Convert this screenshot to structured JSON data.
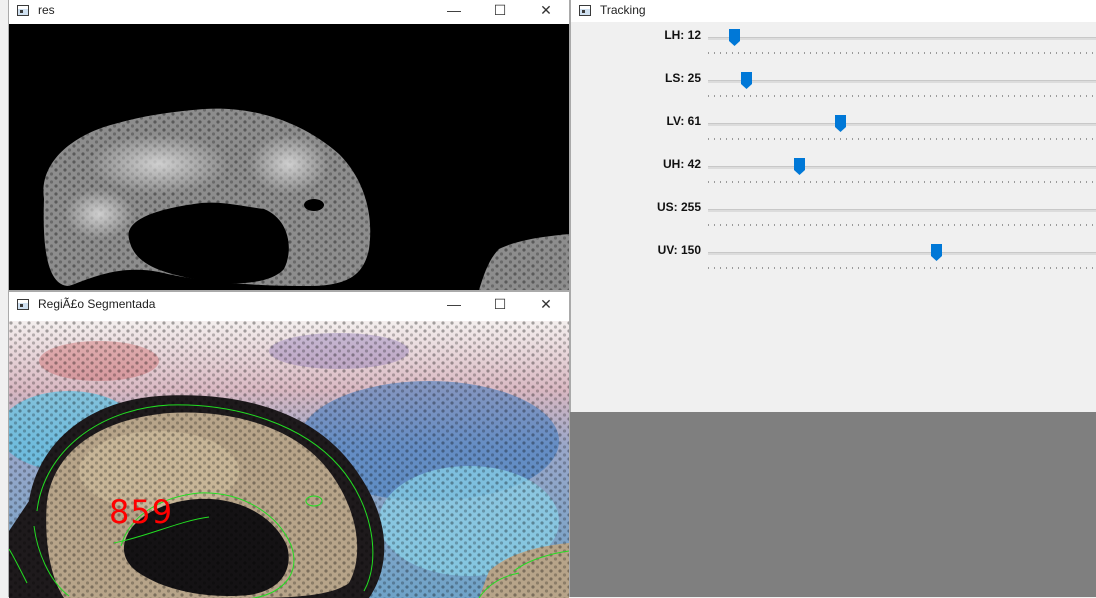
{
  "windows": {
    "res": {
      "title": "res"
    },
    "segmented": {
      "title": "RegiÃ£o Segmentada",
      "count_label": "859"
    },
    "tracking": {
      "title": "Tracking",
      "sliders": [
        {
          "label": "LH: 12",
          "value": 12,
          "max": 179
        },
        {
          "label": "LS: 25",
          "value": 25,
          "max": 255
        },
        {
          "label": "LV: 61",
          "value": 61,
          "max": 179
        },
        {
          "label": "UH: 42",
          "value": 42,
          "max": 179
        },
        {
          "label": "US: 255",
          "value": 255,
          "max": 255
        },
        {
          "label": "UV: 150",
          "value": 150,
          "max": 255
        }
      ]
    }
  },
  "window_controls": {
    "minimize": "—",
    "maximize": "☐",
    "close": "✕"
  },
  "colors": {
    "thumb": "#0078d7",
    "contour": "#22dd22",
    "label": "#ff0000"
  }
}
